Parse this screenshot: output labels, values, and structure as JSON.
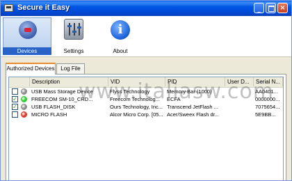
{
  "window": {
    "title": "Secure it Easy",
    "minimize": "_",
    "close": "×"
  },
  "toolbar": {
    "devices_label": "Devices",
    "settings_label": "Settings",
    "about_label": "About",
    "about_glyph": "i"
  },
  "tabs": {
    "authorized_label": "Authorized Devices",
    "log_label": "Log File"
  },
  "table": {
    "columns": [
      "Description",
      "VID",
      "PID",
      "User D...",
      "Serial N..."
    ],
    "rows": [
      {
        "checked": false,
        "status_color": "#8c8c8c",
        "description": "USB Mass Storage Device",
        "vid": "Flyss Technology",
        "pid": "Memory Bar (1000)",
        "user": "",
        "serial": "AA0401..."
      },
      {
        "checked": true,
        "status_color": "#2fcc2f",
        "description": "FREECOM SM-10_CRD...",
        "vid": "Freecom Technolog...",
        "pid": "ECFA",
        "user": "",
        "serial": "0000000..."
      },
      {
        "checked": true,
        "status_color": "#8c8c8c",
        "description": "USB FLASH_DISK",
        "vid": "Ours Technology, Inc...",
        "pid": "Transcend JetFlash ...",
        "user": "",
        "serial": "7075654..."
      },
      {
        "checked": false,
        "status_color": "#d83a2a",
        "description": "MICRO FLASH",
        "vid": "Alcor Micro Corp. [05...",
        "pid": "Acer/Sweex Flash dr...",
        "user": "",
        "serial": "5E9BB..."
      }
    ]
  },
  "watermark": "www.italiasw.com"
}
